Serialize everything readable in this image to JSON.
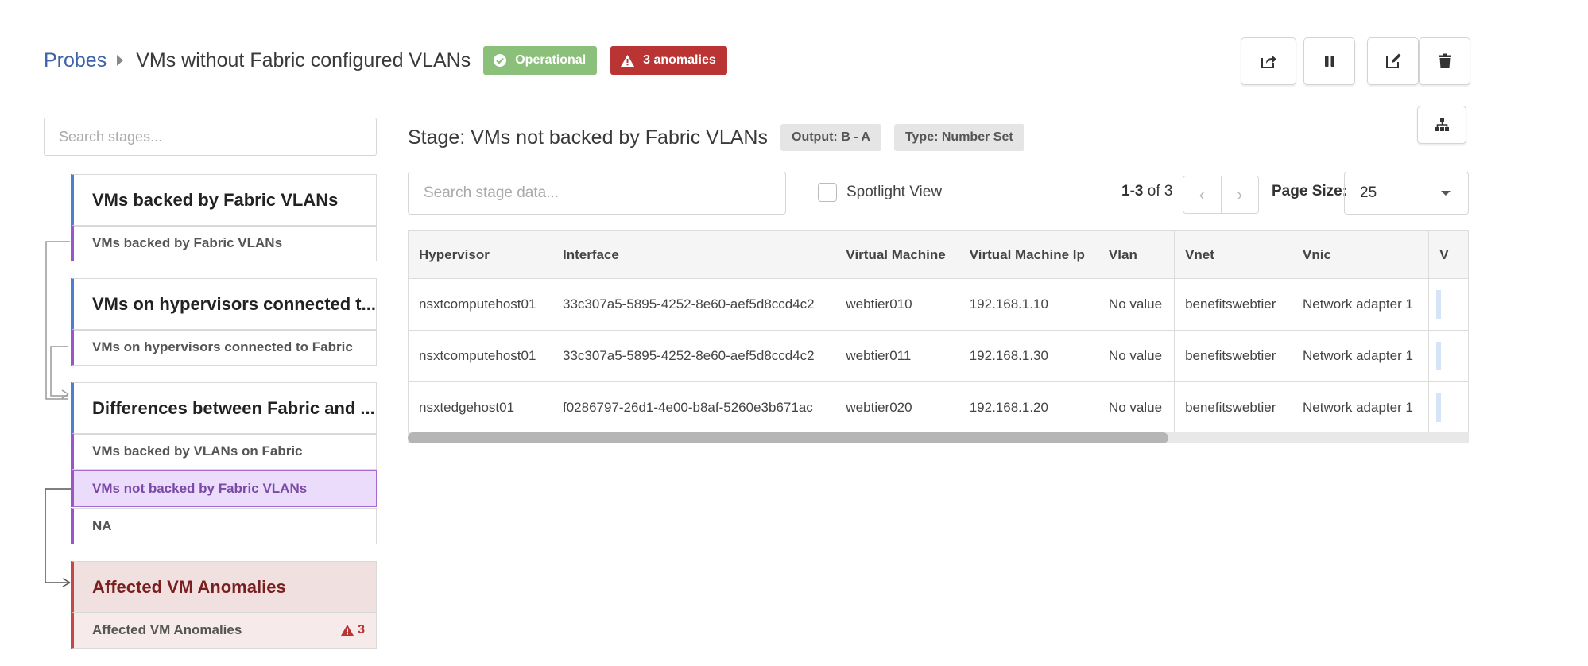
{
  "header": {
    "breadcrumb_link": "Probes",
    "title": "VMs without Fabric configured VLANs",
    "status_badge": "Operational",
    "anomaly_badge": "3 anomalies"
  },
  "left_panel": {
    "search_placeholder": "Search stages...",
    "groups": [
      {
        "title": "VMs backed by Fabric VLANs",
        "items": [
          "VMs backed by Fabric VLANs"
        ]
      },
      {
        "title": "VMs on hypervisors connected t...",
        "items": [
          "VMs on hypervisors connected to Fabric"
        ]
      },
      {
        "title": "Differences between Fabric and ...",
        "items": [
          "VMs backed by VLANs on Fabric",
          "VMs not backed by Fabric VLANs",
          "NA"
        ]
      },
      {
        "title": "Affected VM Anomalies",
        "items": [
          "Affected VM Anomalies"
        ],
        "anomaly_count": "3"
      }
    ]
  },
  "main": {
    "stage_title": "Stage: VMs not backed by Fabric VLANs",
    "output_tag": "Output: B - A",
    "type_tag": "Type: Number Set",
    "search_placeholder": "Search stage data...",
    "spotlight_label": "Spotlight View",
    "paging_range": "1-3",
    "paging_of": " of 3",
    "page_size_label": "Page Size:",
    "page_size_value": "25",
    "table": {
      "columns": [
        "Hypervisor",
        "Interface",
        "Virtual Machine",
        "Virtual Machine Ip",
        "Vlan",
        "Vnet",
        "Vnic",
        "V"
      ],
      "rows": [
        [
          "nsxtcomputehost01",
          "33c307a5-5895-4252-8e60-aef5d8ccd4c2",
          "webtier010",
          "192.168.1.10",
          "No value",
          "benefitswebtier",
          "Network adapter 1"
        ],
        [
          "nsxtcomputehost01",
          "33c307a5-5895-4252-8e60-aef5d8ccd4c2",
          "webtier011",
          "192.168.1.30",
          "No value",
          "benefitswebtier",
          "Network adapter 1"
        ],
        [
          "nsxtedgehost01",
          "f0286797-26d1-4e00-b8af-5260e3b671ac",
          "webtier020",
          "192.168.1.20",
          "No value",
          "benefitswebtier",
          "Network adapter 1"
        ]
      ]
    }
  },
  "colors": {
    "link": "#3d64a8",
    "operational": "#8bc07a",
    "anomaly": "#bb3434",
    "stage_accent": "#4d7fd0",
    "item_accent": "#9a56c8",
    "selected_bg": "#ebdcfb"
  }
}
